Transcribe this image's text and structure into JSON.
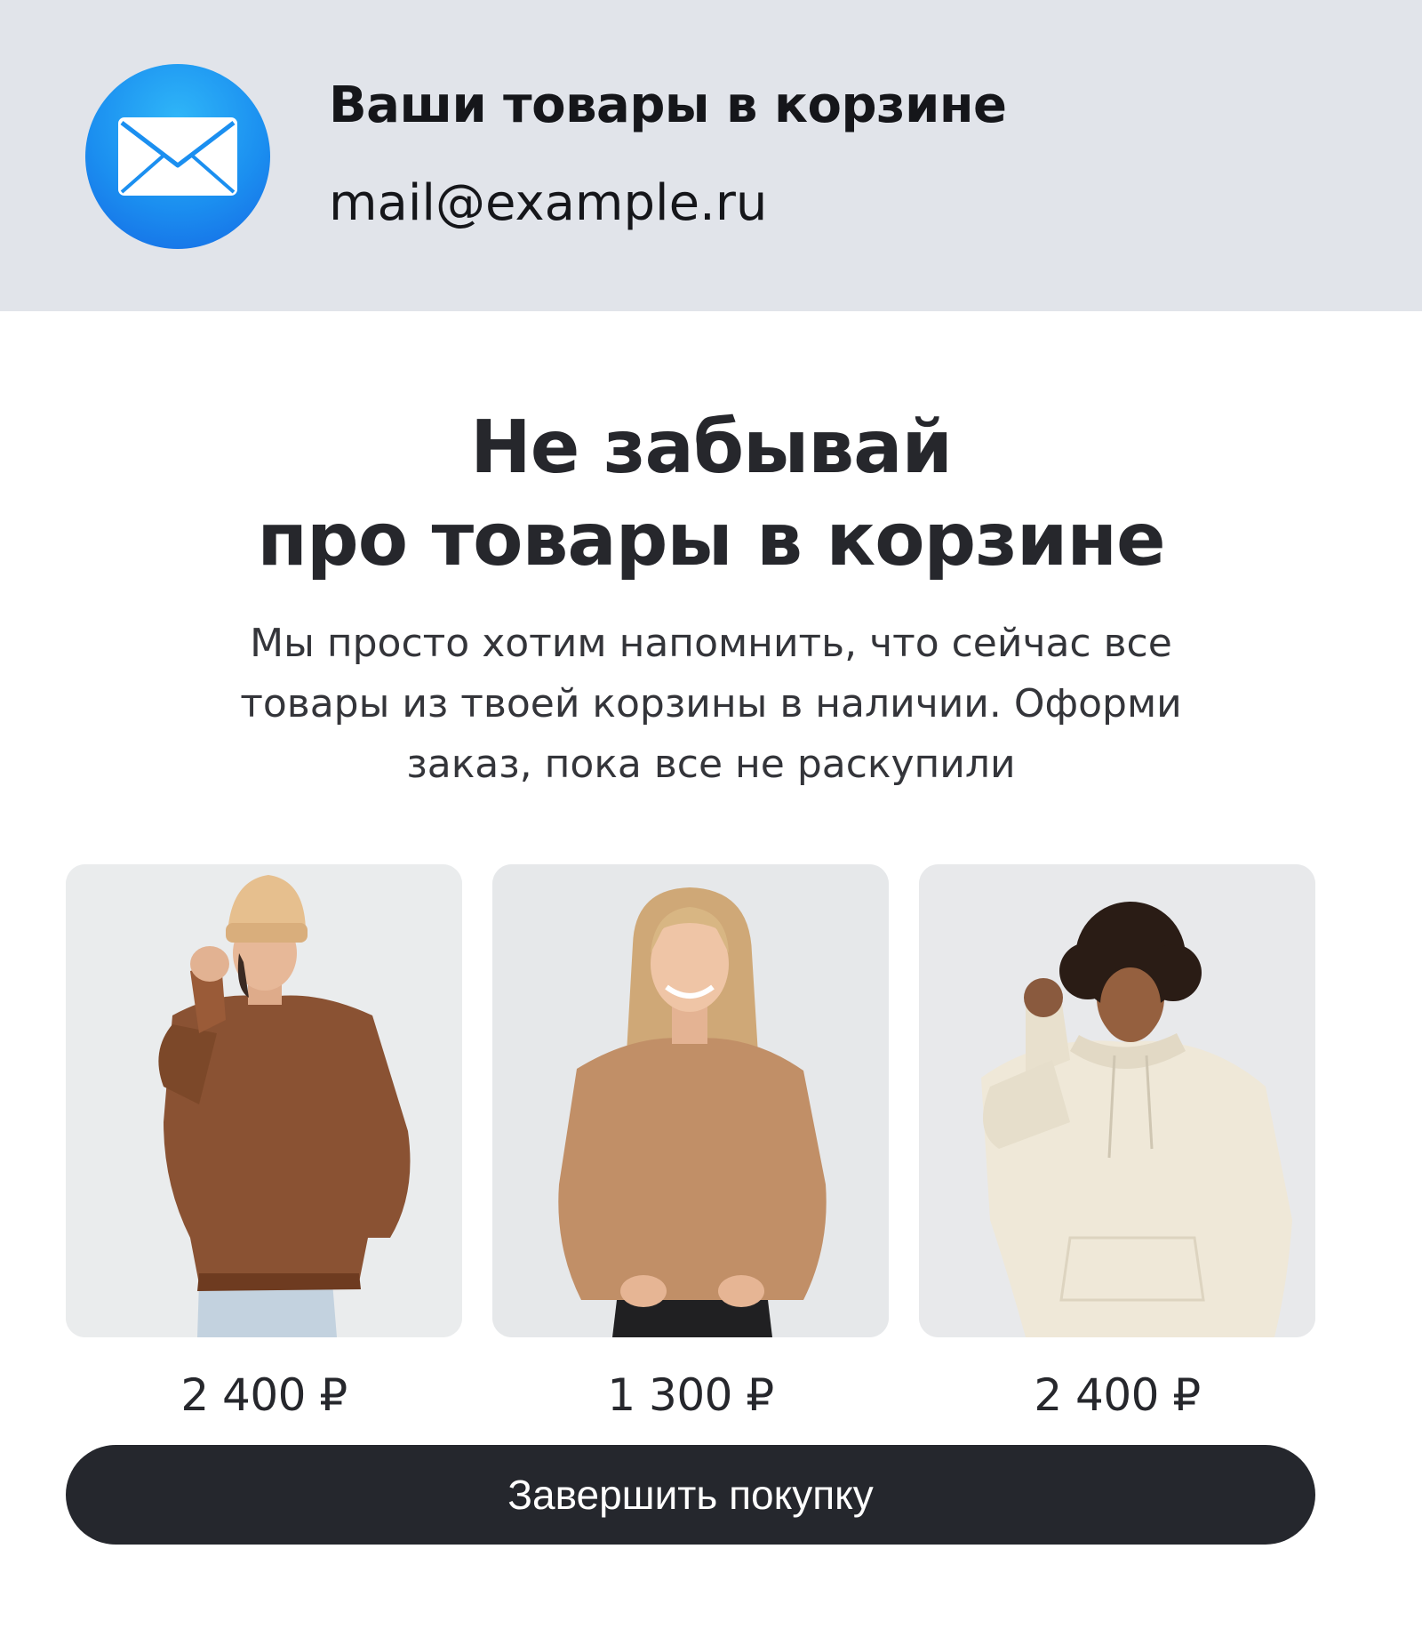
{
  "header": {
    "title": "Ваши товары в корзине",
    "email": "mail@example.ru",
    "icon": "mail-envelope-icon",
    "icon_color": "#1b8ff0"
  },
  "main": {
    "headline_line1": "Не забывай",
    "headline_line2": "про товары в корзине",
    "subtext_line1": "Мы просто хотим напомнить, что сейчас все",
    "subtext_line2": "товары из твоей корзины в наличии. Оформи",
    "subtext_line3": "заказ, пока все не раскупили"
  },
  "products": [
    {
      "image": "woman-in-brown-sweatshirt-and-beige-beanie-photo",
      "price": "2 400 ₽"
    },
    {
      "image": "blonde-woman-in-tan-sweatshirt-photo",
      "price": "1 300 ₽"
    },
    {
      "image": "curly-haired-woman-in-cream-hoodie-photo",
      "price": "2 400 ₽"
    }
  ],
  "cta": {
    "label": "Завершить покупку",
    "color": "#25272d"
  }
}
